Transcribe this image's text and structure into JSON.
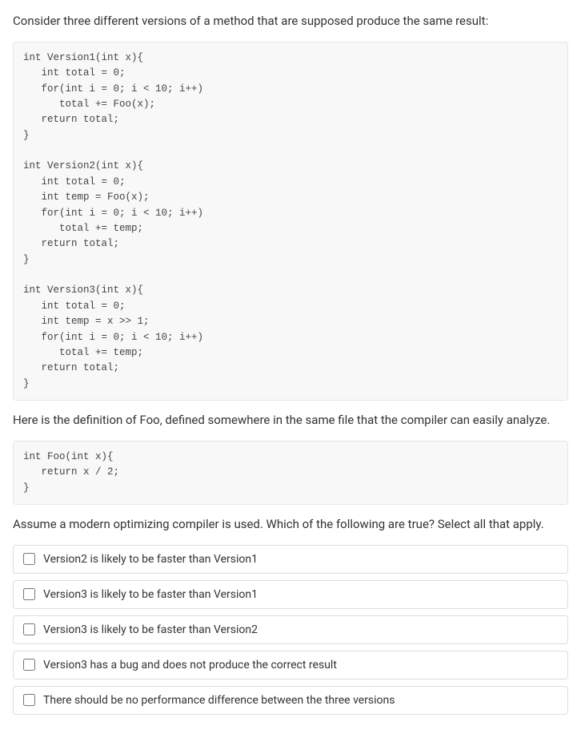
{
  "intro": "Consider three different versions of a method that are supposed produce the same result:",
  "code1": "int Version1(int x){\n   int total = 0;\n   for(int i = 0; i < 10; i++)\n      total += Foo(x);\n   return total;\n}\n\nint Version2(int x){\n   int total = 0;\n   int temp = Foo(x);\n   for(int i = 0; i < 10; i++)\n      total += temp;\n   return total;\n}\n\nint Version3(int x){\n   int total = 0;\n   int temp = x >> 1;\n   for(int i = 0; i < 10; i++)\n      total += temp;\n   return total;\n}",
  "mid": "Here is the definition of Foo, defined somewhere in the same file that the compiler can easily analyze.",
  "code2": "int Foo(int x){\n   return x / 2;\n}",
  "prompt": "Assume a modern optimizing compiler is used. Which of the following are true? Select all that apply.",
  "options": [
    "Version2 is likely to be faster than Version1",
    "Version3 is likely to be faster than Version1",
    "Version3 is likely to be faster than Version2",
    "Version3 has a bug and does not produce the correct result",
    "There should be no performance difference between the three versions"
  ]
}
